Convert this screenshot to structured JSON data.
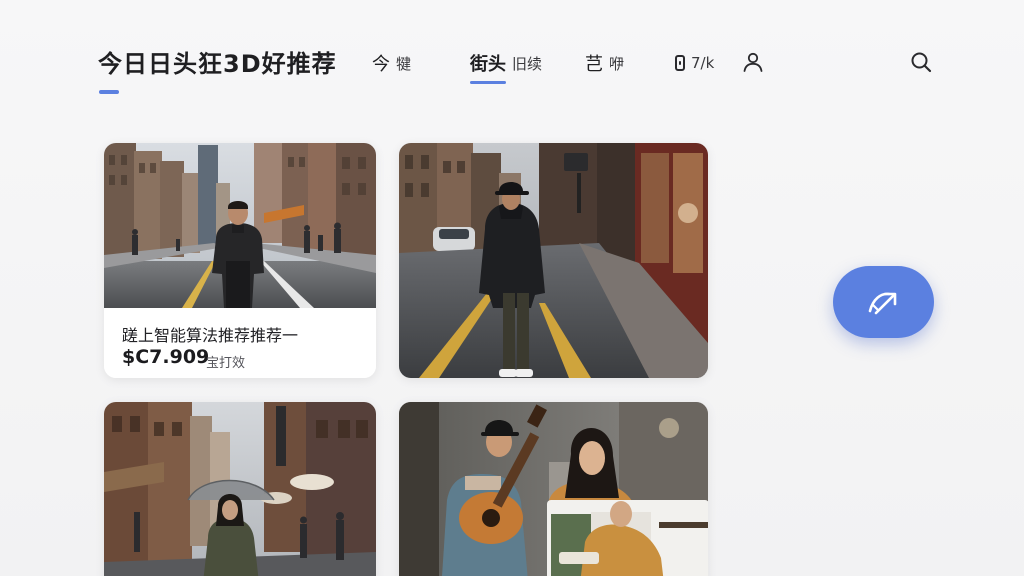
{
  "header": {
    "title": "今日日头狂3D好推荐"
  },
  "nav": {
    "items": [
      {
        "lead": "今",
        "rest": "犍"
      },
      {
        "lead": "街头",
        "rest": "旧续"
      },
      {
        "lead": "芑",
        "rest": "咿"
      },
      {
        "lead": "",
        "rest": "7/k"
      }
    ],
    "active_index": 1,
    "user_icon": "user-icon",
    "search_icon": "search-icon"
  },
  "feed": {
    "cards": [
      {
        "title": "蹉上智能算法推荐推荐一",
        "price": "$C7.909",
        "meta": "宝打效",
        "scene": "street-man-black-jacket"
      },
      {
        "scene": "street-man-black-hoodie-cap"
      },
      {
        "scene": "street-woman-umbrella"
      },
      {
        "scene": "musician-guitar-and-woman"
      }
    ]
  },
  "fab": {
    "icon": "trending-arrow-icon"
  },
  "colors": {
    "accent": "#5b80e0",
    "background": "#f4f4f5",
    "text": "#1c1c1f"
  }
}
